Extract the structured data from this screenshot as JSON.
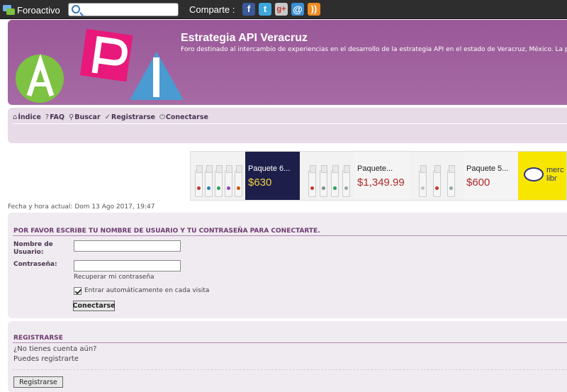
{
  "topbar": {
    "brand": "Foroactivo",
    "search_value": "",
    "share_label": "Comparte :",
    "social_icons": [
      "facebook-icon",
      "twitter-icon",
      "googleplus-icon",
      "email-icon",
      "rss-icon"
    ]
  },
  "header": {
    "title": "Estrategia API Veracruz",
    "description": "Foro destinado al intercambio de experiencias en el desarrollo de la estrategia API en el estado de Veracruz, México. La pa"
  },
  "nav": {
    "items": [
      {
        "label": "Índice",
        "icon": "home-icon"
      },
      {
        "label": "FAQ",
        "icon": "help-icon"
      },
      {
        "label": "Buscar",
        "icon": "search-icon"
      },
      {
        "label": "Registrarse",
        "icon": "register-icon"
      },
      {
        "label": "Conectarse",
        "icon": "login-icon"
      }
    ]
  },
  "ads": [
    {
      "title": "Paquete 6...",
      "price": "$630"
    },
    {
      "title": "Paquete...",
      "price": "$1,349.99"
    },
    {
      "title": "Paquete 5...",
      "price": "$600"
    },
    {
      "brand_line1": "merc",
      "brand_line2": "libr"
    }
  ],
  "datetime": "Fecha y hora actual: Dom 13 Ago 2017, 19:47",
  "login": {
    "heading": "POR FAVOR ESCRIBE TU NOMBRE DE USUARIO Y TU CONTRASEÑA PARA CONECTARTE.",
    "username_label_1": "Nombre de",
    "username_label_2": "Usuario:",
    "username_value": "",
    "password_label": "Contraseña:",
    "password_value": "",
    "recover_link": "Recuperar mi contraseña",
    "remember_label": "Entrar automáticamente en cada visita",
    "remember_checked": true,
    "submit_label": "Conectarse"
  },
  "register": {
    "heading": "REGISTRARSE",
    "line1": "¿No tienes cuenta aún?",
    "line2": "Puedes registrarte",
    "button_label": "Registrarse"
  },
  "colors": {
    "header_purple": "#a066a0",
    "nav_bg": "#e6dbe7",
    "panel_bg": "#efebf0",
    "heading_color": "#6e3a70",
    "logo_green": "#7dc242",
    "logo_pink": "#e8197a",
    "logo_blue": "#4a9bd1"
  }
}
